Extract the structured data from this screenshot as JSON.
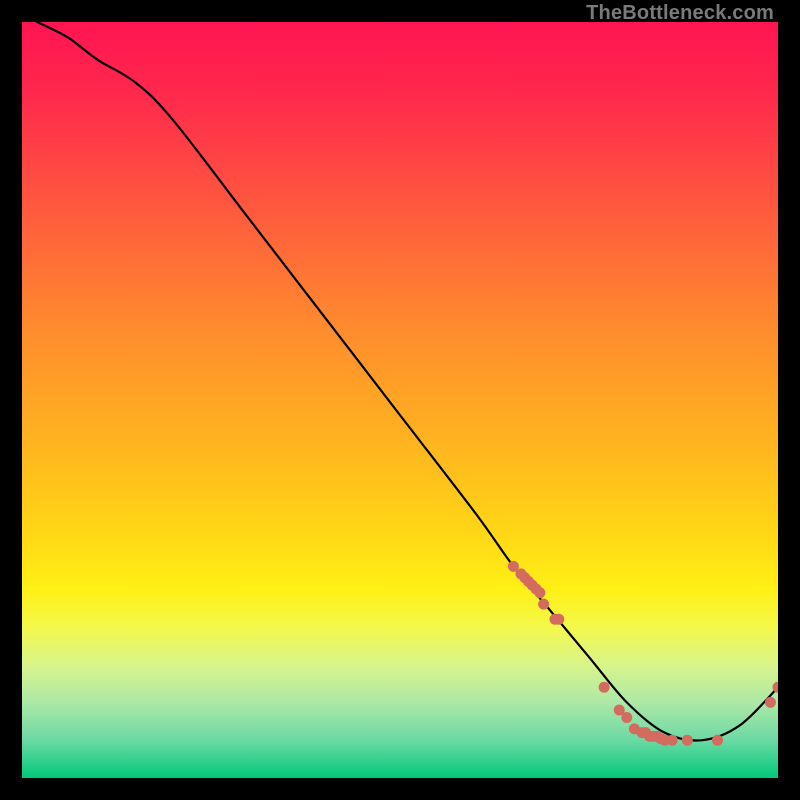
{
  "watermark": "TheBottleneck.com",
  "chart_data": {
    "type": "line",
    "title": "",
    "xlabel": "",
    "ylabel": "",
    "xlim": [
      0,
      100
    ],
    "ylim": [
      0,
      100
    ],
    "grid": false,
    "legend": false,
    "series": [
      {
        "name": "curve",
        "style": "line",
        "color": "#000000",
        "x": [
          2,
          6,
          10,
          15,
          20,
          30,
          40,
          50,
          60,
          65,
          70,
          75,
          80,
          85,
          90,
          95,
          100
        ],
        "y": [
          100,
          98,
          95,
          92,
          87,
          74,
          61,
          48,
          35,
          28,
          22,
          16,
          10,
          6,
          5,
          7,
          12
        ]
      },
      {
        "name": "markers",
        "style": "points",
        "color": "#d36b5f",
        "x": [
          65,
          66,
          66.5,
          67,
          67.5,
          68,
          68.5,
          69,
          70.5,
          71,
          77,
          79,
          80,
          81,
          82,
          82.5,
          83,
          83.5,
          84,
          84.5,
          85,
          86,
          88,
          92,
          99,
          100
        ],
        "y": [
          28,
          27,
          26.5,
          26,
          25.5,
          25,
          24.5,
          23,
          21,
          21,
          12,
          9,
          8,
          6.5,
          6,
          6,
          5.5,
          5.5,
          5.5,
          5.2,
          5,
          5,
          5,
          5,
          10,
          12
        ]
      }
    ]
  }
}
